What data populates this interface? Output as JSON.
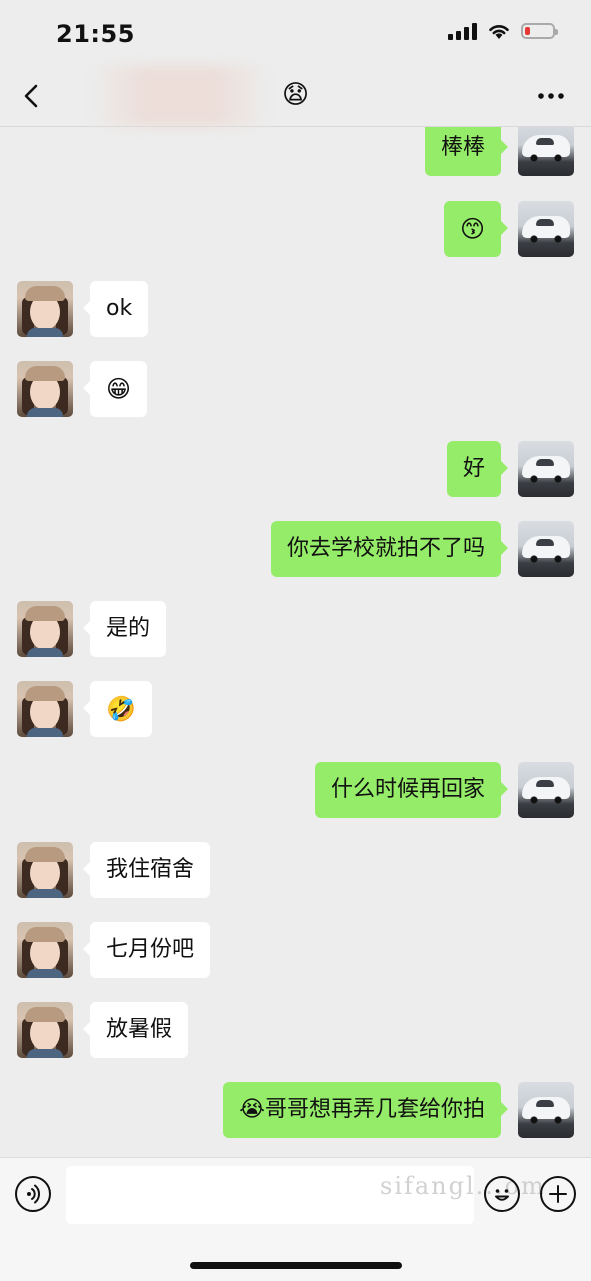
{
  "status_bar": {
    "time": "21:55"
  },
  "nav": {
    "title": "😧"
  },
  "messages": [
    {
      "side": "out",
      "text": "棒棒"
    },
    {
      "side": "out",
      "text": "😙"
    },
    {
      "side": "in",
      "text": "ok"
    },
    {
      "side": "in",
      "text": "😁"
    },
    {
      "side": "out",
      "text": "好"
    },
    {
      "side": "out",
      "text": "你去学校就拍不了吗"
    },
    {
      "side": "in",
      "text": "是的"
    },
    {
      "side": "in",
      "text": "🤣"
    },
    {
      "side": "out",
      "text": "什么时候再回家"
    },
    {
      "side": "in",
      "text": "我住宿舍"
    },
    {
      "side": "in",
      "text": "七月份吧"
    },
    {
      "side": "in",
      "text": "放暑假"
    },
    {
      "side": "out",
      "text": "😭哥哥想再弄几套给你拍"
    }
  ],
  "input": {
    "placeholder": "",
    "watermark": "sifangl...om"
  },
  "colors": {
    "out_bubble": "#95ec69",
    "in_bubble": "#ffffff",
    "background": "#ededed"
  }
}
